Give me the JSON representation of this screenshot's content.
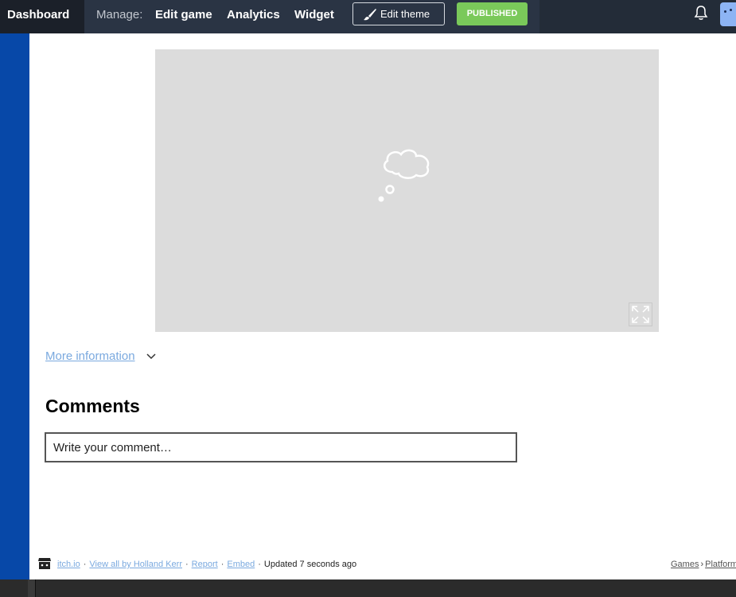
{
  "topbar": {
    "brand": "Dashboard",
    "manage_label": "Manage:",
    "links": [
      "Edit game",
      "Analytics",
      "Widget"
    ],
    "edit_theme_label": "Edit theme",
    "status_label": "PUBLISHED",
    "status_color": "#7ac95a"
  },
  "main": {
    "more_info_label": "More information",
    "comments_title": "Comments",
    "comment_placeholder": "Write your comment…"
  },
  "footer": {
    "site_link": "itch.io",
    "view_all_link": "View all by Holland Kerr",
    "report_link": "Report",
    "embed_link": "Embed",
    "updated_text": "Updated 7 seconds ago",
    "category_root": "Games",
    "category_sub": "Platformer"
  },
  "colors": {
    "topbar_bg": "#232c38",
    "sidebar_accent": "#0748a8",
    "link": "#7aa9df"
  },
  "icons": [
    "brush-icon",
    "bell-icon",
    "avatar",
    "thought-bubble-icon",
    "fullscreen-icon",
    "chevron-down-icon",
    "itchio-logo-icon"
  ]
}
